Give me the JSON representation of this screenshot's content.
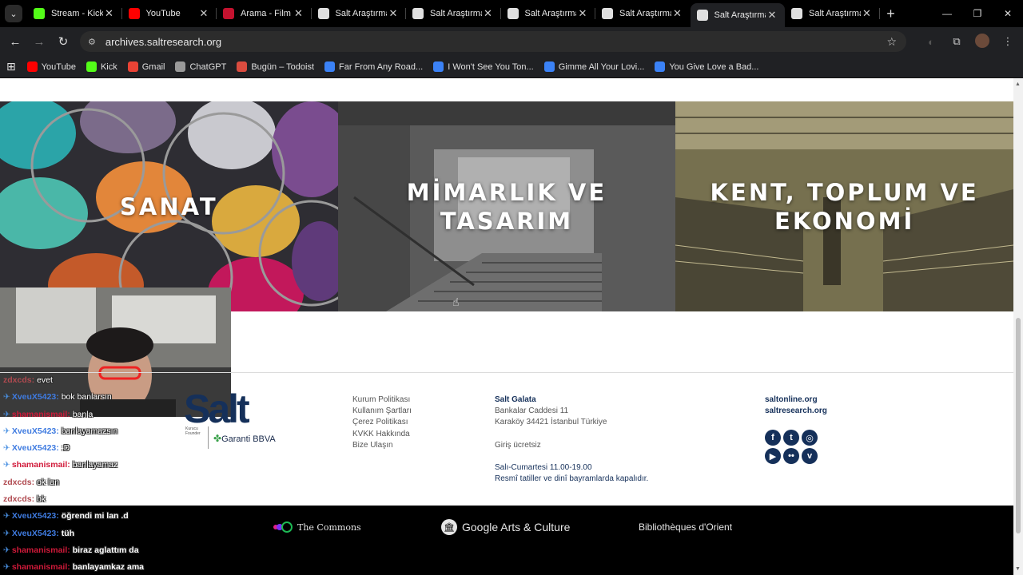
{
  "browser": {
    "tabs": [
      {
        "title": "Stream - Kick",
        "favicon": "kick-icon",
        "color": "#53fc18"
      },
      {
        "title": "YouTube",
        "favicon": "youtube-icon",
        "color": "#ff0000"
      },
      {
        "title": "Arama - Film",
        "favicon": "film-icon",
        "color": "#c4122f"
      },
      {
        "title": "Salt Araştırma",
        "favicon": "salt-icon",
        "color": "#e0e0e0"
      },
      {
        "title": "Salt Araştırma",
        "favicon": "salt-icon",
        "color": "#e0e0e0"
      },
      {
        "title": "Salt Araştırma",
        "favicon": "salt-icon",
        "color": "#e0e0e0"
      },
      {
        "title": "Salt Araştırma",
        "favicon": "salt-icon",
        "color": "#e0e0e0"
      },
      {
        "title": "Salt Araştırma",
        "favicon": "salt-icon",
        "color": "#e0e0e0"
      },
      {
        "title": "Salt Araştırma",
        "favicon": "salt-icon",
        "color": "#e0e0e0"
      }
    ],
    "active_tab": 7,
    "url": "archives.saltresearch.org",
    "bookmarks": [
      {
        "label": "YouTube",
        "icon": "youtube-icon",
        "color": "#ff0000"
      },
      {
        "label": "Kick",
        "icon": "kick-icon",
        "color": "#53fc18"
      },
      {
        "label": "Gmail",
        "icon": "gmail-icon",
        "color": "#ea4335"
      },
      {
        "label": "ChatGPT",
        "icon": "chatgpt-icon",
        "color": "#9a9a9a"
      },
      {
        "label": "Bugün – Todoist",
        "icon": "todoist-icon",
        "color": "#db4c3f"
      },
      {
        "label": "Far From Any Road...",
        "icon": "bookmark-page-icon",
        "color": "#3b82f6"
      },
      {
        "label": "I Won't See You Ton...",
        "icon": "bookmark-page-icon",
        "color": "#3b82f6"
      },
      {
        "label": "Gimme All Your Lovi...",
        "icon": "bookmark-page-icon",
        "color": "#3b82f6"
      },
      {
        "label": "You Give Love a Bad...",
        "icon": "bookmark-page-icon",
        "color": "#3b82f6"
      }
    ]
  },
  "tiles": [
    {
      "label": "SANAT"
    },
    {
      "label": "MİMARLIK VE TASARIM"
    },
    {
      "label": "KENT, TOPLUM VE EKONOMİ"
    }
  ],
  "footer": {
    "logo": {
      "brand": "Salt",
      "founder": "Kurucu Founder",
      "partner": "Garanti BBVA"
    },
    "links": [
      "Kurum Politikası",
      "Kullanım Şartları",
      "Çerez Politikası",
      "KVKK Hakkında",
      "Bize Ulaşın"
    ],
    "location": {
      "name": "Salt Galata",
      "address_1": "Bankalar Caddesi 11",
      "address_2": "Karaköy 34421 İstanbul Türkiye",
      "entry": "Giriş ücretsiz",
      "hours": "Salı-Cumartesi 11.00-19.00",
      "closed": "Resmî tatiller ve dinî bayramlarda kapalıdır."
    },
    "sites": [
      "saltonline.org",
      "saltresearch.org"
    ],
    "social": [
      "facebook-icon",
      "twitter-icon",
      "instagram-icon",
      "youtube-icon",
      "flickr-icon",
      "vimeo-icon"
    ],
    "partners": [
      "The Commons",
      "Google Arts & Culture",
      "Bibliothèques d'Orient"
    ],
    "brand_color": "#15305a"
  },
  "chat": [
    {
      "user": "zdxcds",
      "text": "evet",
      "color": "brown",
      "badge": false
    },
    {
      "user": "XveuX5423",
      "text": "bok banlarsın",
      "color": "blue",
      "badge": true
    },
    {
      "user": "shamanismail",
      "text": "banla",
      "color": "red",
      "badge": true
    },
    {
      "user": "XveuX5423",
      "text": "banlayamazsın",
      "color": "blue",
      "badge": true
    },
    {
      "user": "XveuX5423",
      "text": ":D",
      "color": "blue",
      "badge": true
    },
    {
      "user": "shamanismail",
      "text": "banlayamaz",
      "color": "red",
      "badge": true
    },
    {
      "user": "zdxcds",
      "text": "ok lan",
      "color": "brown",
      "badge": false
    },
    {
      "user": "zdxcds",
      "text": "bk",
      "color": "brown",
      "badge": false
    },
    {
      "user": "XveuX5423",
      "text": "öğrendi mi lan .d",
      "color": "blue",
      "badge": true
    },
    {
      "user": "XveuX5423",
      "text": "tüh",
      "color": "blue",
      "badge": true
    },
    {
      "user": "shamanismail",
      "text": "biraz aglattım da",
      "color": "red",
      "badge": true
    },
    {
      "user": "shamanismail",
      "text": "banlayamkaz ama",
      "color": "red",
      "badge": true
    }
  ]
}
